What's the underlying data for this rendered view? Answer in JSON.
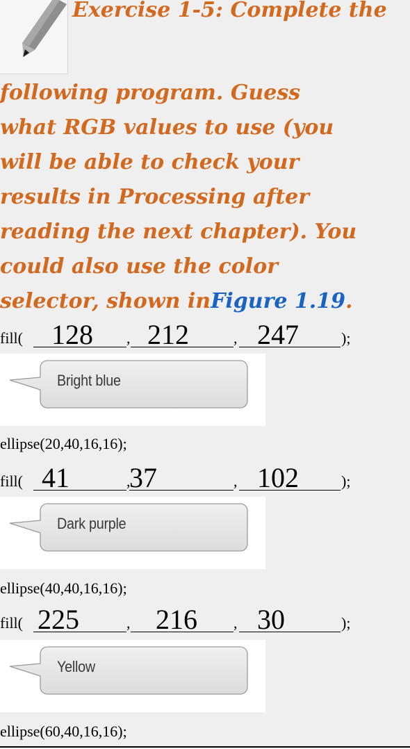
{
  "exercise": {
    "line1": "Exercise 1-5: Complete the",
    "rows": [
      "following program. Guess",
      "what RGB values to use (you",
      "will be able to check your",
      "results in Processing after",
      "reading the next chapter). You",
      "could also use the color"
    ],
    "last_row_prefix": "selector, shown in",
    "figure_link": "Figure 1.19",
    "last_row_suffix": "."
  },
  "code": {
    "fill_prefix": "fill(",
    "comma": ",",
    "end": ");",
    "blocks": [
      {
        "r": "128",
        "g": "212",
        "b": "247",
        "callout": "Bright blue",
        "ellipse": "ellipse(20,40,16,16);"
      },
      {
        "r": "41",
        "g": "37",
        "b": "102",
        "callout": "Dark purple",
        "ellipse": "ellipse(40,40,16,16);"
      },
      {
        "r": "225",
        "g": "216",
        "b": "30",
        "callout": "Yellow",
        "ellipse": "ellipse(60,40,16,16);"
      }
    ]
  },
  "icons": {
    "pencil": "pencil-icon",
    "callout": "speech-bubble-icon"
  }
}
